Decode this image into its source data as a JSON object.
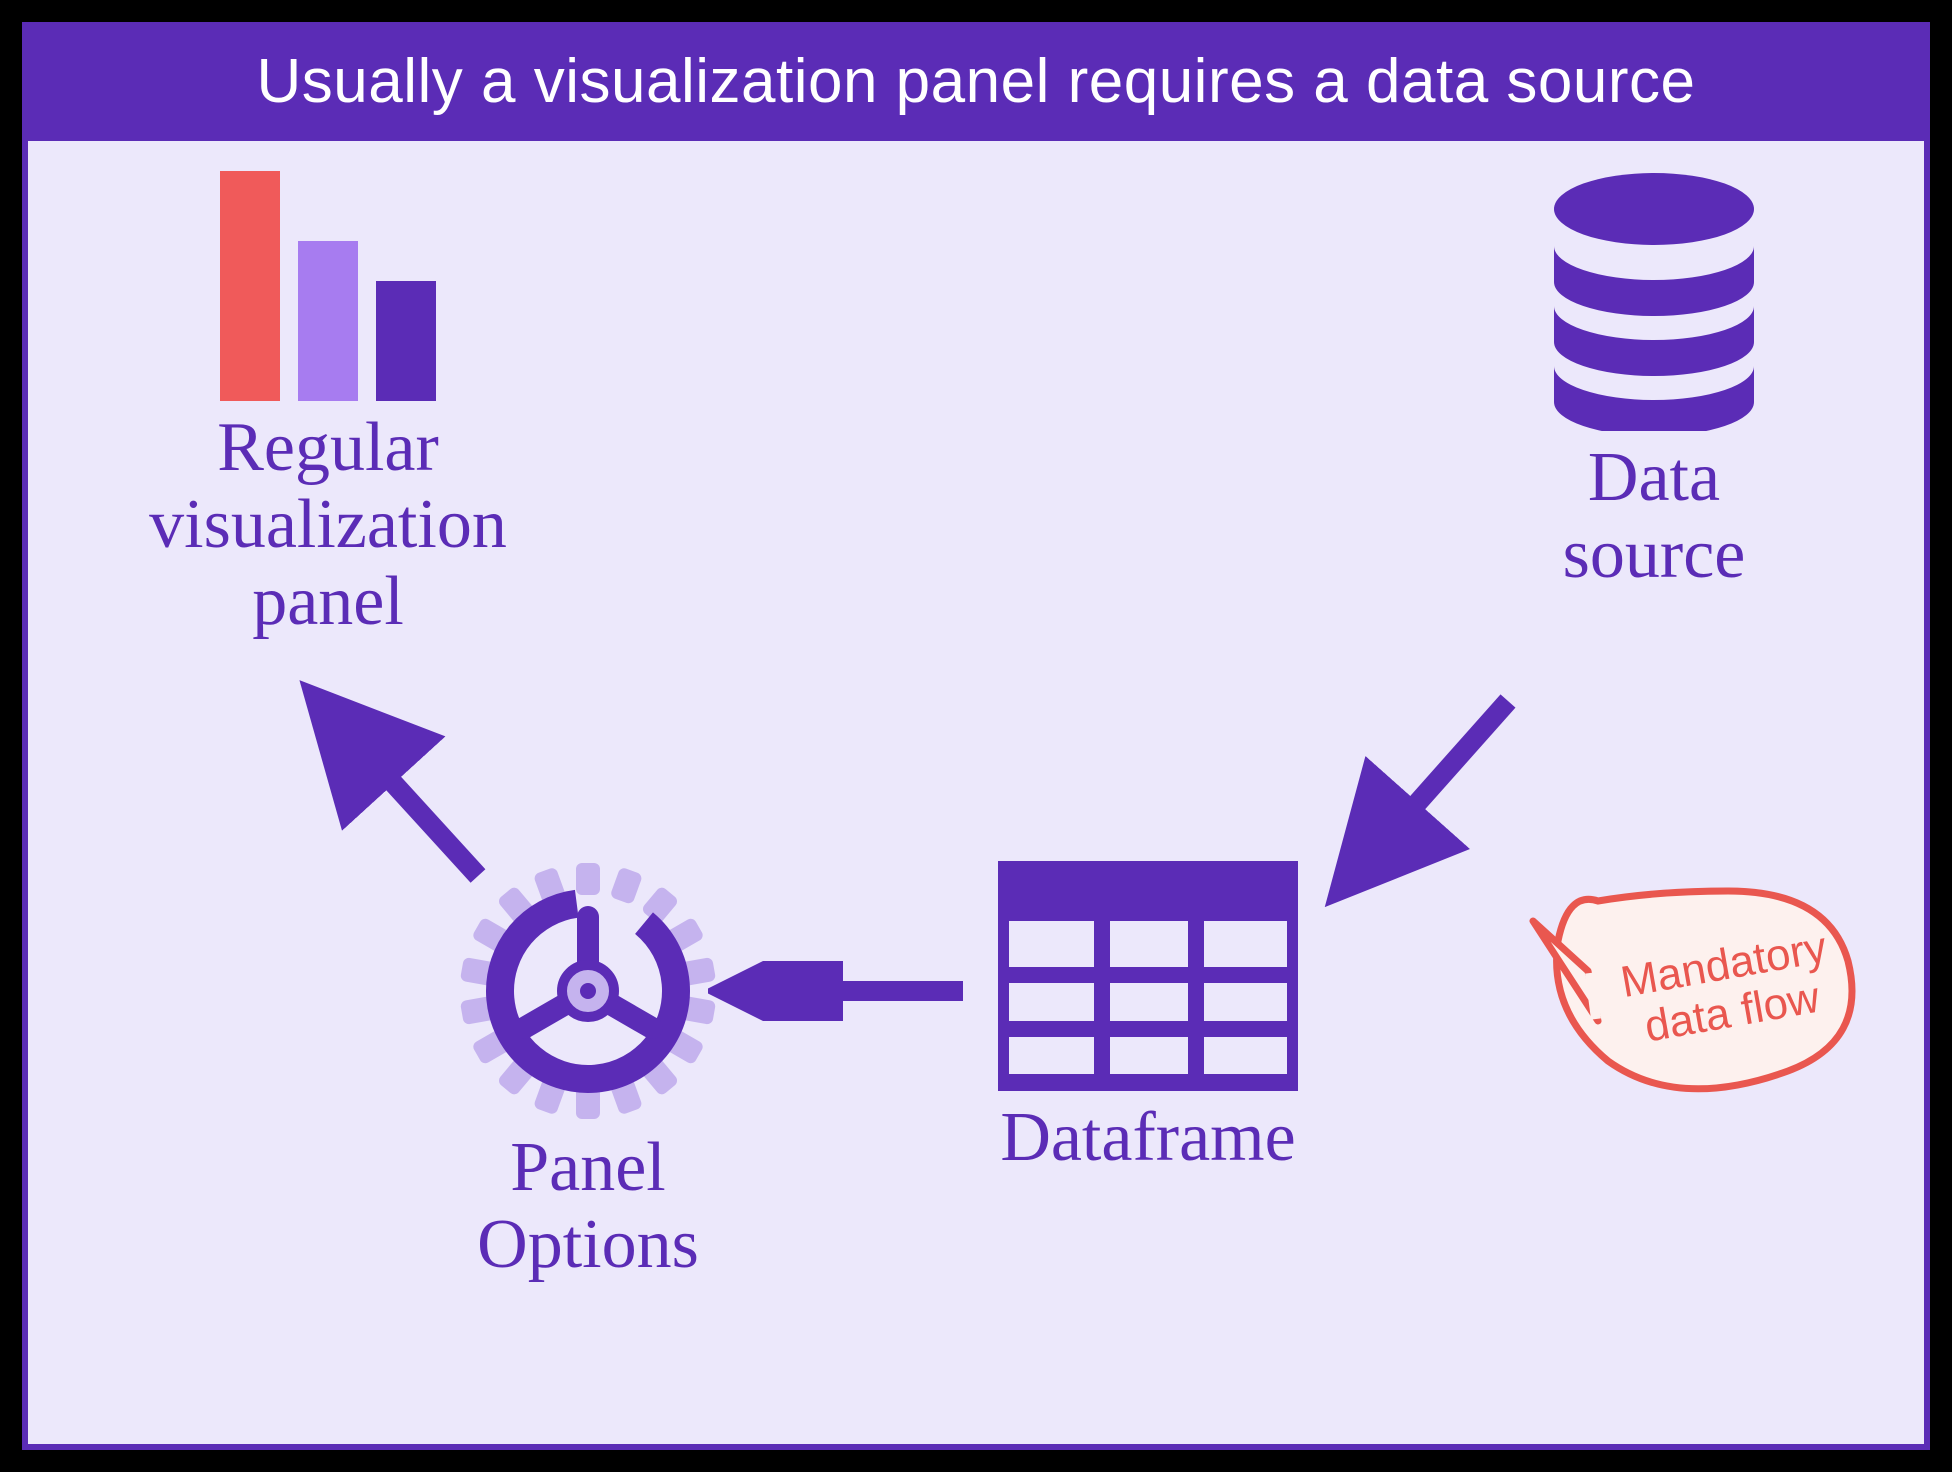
{
  "title": "Usually a visualization panel requires a data source",
  "nodes": {
    "viz_panel": {
      "label_line1": "Regular",
      "label_line2": "visualization",
      "label_line3": "panel"
    },
    "panel_options": {
      "label_line1": "Panel",
      "label_line2": "Options"
    },
    "dataframe": {
      "label": "Dataframe"
    },
    "data_source": {
      "label_line1": "Data",
      "label_line2": "source"
    }
  },
  "callout": {
    "line1": "Mandatory",
    "line2": "data flow"
  },
  "flow": [
    "data_source -> dataframe",
    "dataframe -> panel_options",
    "panel_options -> viz_panel"
  ],
  "colors": {
    "primary": "#5b2cb6",
    "accent_red": "#f05a5a",
    "accent_lilac": "#a77cf0",
    "callout_stroke": "#e9574f",
    "callout_fill": "#fdf1ee",
    "panel_bg": "#ece8fb"
  }
}
